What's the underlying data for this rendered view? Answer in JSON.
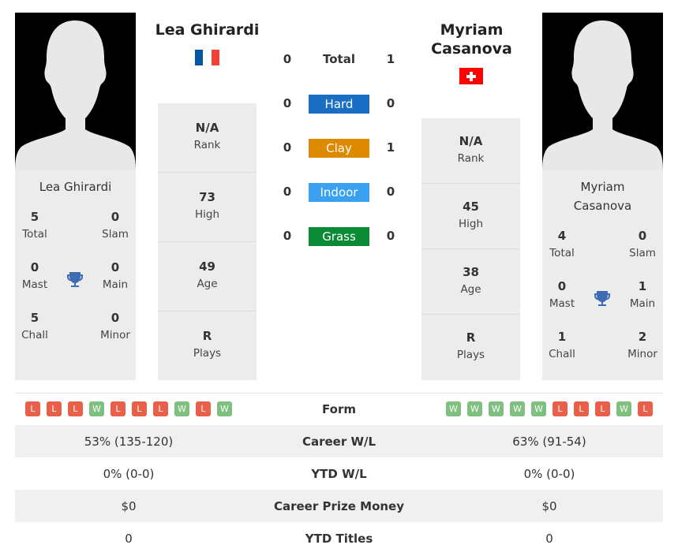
{
  "player1": {
    "name": "Lea Ghirardi",
    "card_name": "Lea Ghirardi",
    "flag": "france-flag",
    "flag_colors": [
      "#0055a4",
      "#ffffff",
      "#ef4135"
    ],
    "stats": {
      "total": {
        "value": "5",
        "label": "Total"
      },
      "slam": {
        "value": "0",
        "label": "Slam"
      },
      "mast": {
        "value": "0",
        "label": "Mast"
      },
      "main": {
        "value": "0",
        "label": "Main"
      },
      "chall": {
        "value": "5",
        "label": "Chall"
      },
      "minor": {
        "value": "0",
        "label": "Minor"
      }
    },
    "info": {
      "rank": {
        "value": "N/A",
        "label": "Rank"
      },
      "high": {
        "value": "73",
        "label": "High"
      },
      "age": {
        "value": "49",
        "label": "Age"
      },
      "plays": {
        "value": "R",
        "label": "Plays"
      }
    },
    "form": [
      "L",
      "L",
      "L",
      "W",
      "L",
      "L",
      "L",
      "W",
      "L",
      "W"
    ]
  },
  "player2": {
    "name": "Myriam Casanova",
    "name_line1": "Myriam",
    "name_line2": "Casanova",
    "flag": "switzerland-flag",
    "stats": {
      "total": {
        "value": "4",
        "label": "Total"
      },
      "slam": {
        "value": "0",
        "label": "Slam"
      },
      "mast": {
        "value": "0",
        "label": "Mast"
      },
      "main": {
        "value": "1",
        "label": "Main"
      },
      "chall": {
        "value": "1",
        "label": "Chall"
      },
      "minor": {
        "value": "2",
        "label": "Minor"
      }
    },
    "info": {
      "rank": {
        "value": "N/A",
        "label": "Rank"
      },
      "high": {
        "value": "45",
        "label": "High"
      },
      "age": {
        "value": "38",
        "label": "Age"
      },
      "plays": {
        "value": "R",
        "label": "Plays"
      }
    },
    "form": [
      "W",
      "W",
      "W",
      "W",
      "W",
      "L",
      "L",
      "L",
      "W",
      "L"
    ]
  },
  "h2h": {
    "total": {
      "label": "Total",
      "p1": "0",
      "p2": "1"
    },
    "surfaces": [
      {
        "label": "Hard",
        "p1": "0",
        "p2": "0",
        "color": "#1a6fc4"
      },
      {
        "label": "Clay",
        "p1": "0",
        "p2": "1",
        "color": "#dd8a00"
      },
      {
        "label": "Indoor",
        "p1": "0",
        "p2": "0",
        "color": "#3aa0f0"
      },
      {
        "label": "Grass",
        "p1": "0",
        "p2": "0",
        "color": "#0b8a36"
      }
    ]
  },
  "comparison": {
    "form_label": "Form",
    "rows": [
      {
        "label": "Career W/L",
        "p1": "53% (135-120)",
        "p2": "63% (91-54)"
      },
      {
        "label": "YTD W/L",
        "p1": "0% (0-0)",
        "p2": "0% (0-0)"
      },
      {
        "label": "Career Prize Money",
        "p1": "$0",
        "p2": "$0"
      },
      {
        "label": "YTD Titles",
        "p1": "0",
        "p2": "0"
      }
    ]
  }
}
